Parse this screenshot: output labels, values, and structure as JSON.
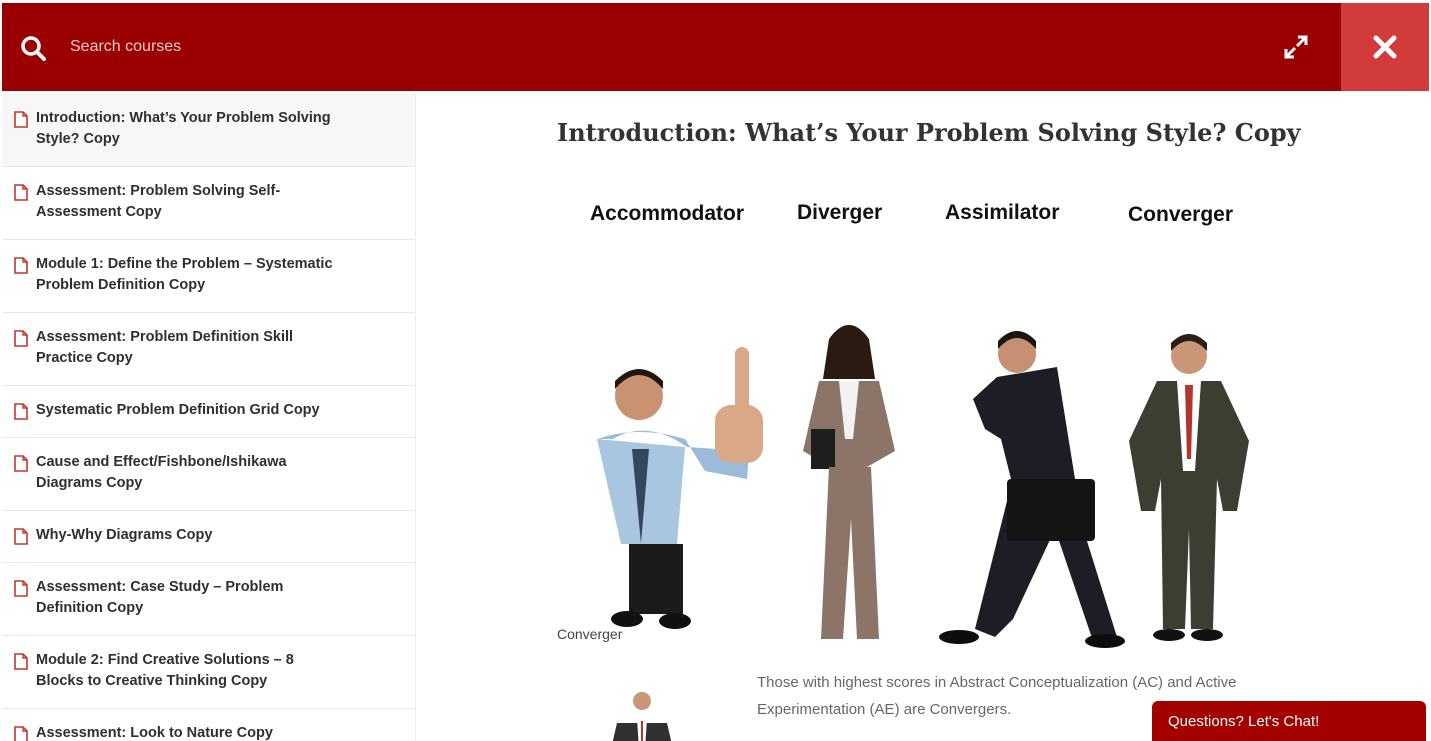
{
  "header": {
    "search_placeholder": "Search courses",
    "search_icon": "search-icon",
    "expand_icon": "expand-icon",
    "close_icon": "close-icon",
    "bar_color": "#9b0000",
    "close_bg_color": "#d23b3b"
  },
  "sidebar": {
    "items": [
      {
        "label": "Introduction: What’s Your Problem Solving Style? Copy",
        "icon": "document-icon"
      },
      {
        "label": "Assessment: Problem Solving Self-Assessment Copy",
        "icon": "document-icon"
      },
      {
        "label": "Module 1: Define the Problem – Systematic Problem Definition Copy",
        "icon": "document-icon"
      },
      {
        "label": "Assessment: Problem Definition Skill Practice Copy",
        "icon": "document-icon"
      },
      {
        "label": "Systematic Problem Definition Grid Copy",
        "icon": "document-icon"
      },
      {
        "label": "Cause and Effect/Fishbone/Ishikawa Diagrams Copy",
        "icon": "document-icon"
      },
      {
        "label": "Why-Why Diagrams Copy",
        "icon": "document-icon"
      },
      {
        "label": "Assessment: Case Study – Problem Definition Copy",
        "icon": "document-icon"
      },
      {
        "label": "Module 2: Find Creative Solutions – 8 Blocks to Creative Thinking Copy",
        "icon": "document-icon"
      },
      {
        "label": "Assessment: Look to Nature Copy",
        "icon": "document-icon"
      }
    ]
  },
  "main": {
    "title": "Introduction: What’s Your Problem Solving Style? Copy",
    "figure_labels": [
      "Accommodator",
      "Diverger",
      "Assimilator",
      "Converger"
    ],
    "caption": "Converger",
    "description": "Those with highest scores in Abstract Conceptualization (AC) and Active Experimentation (AE) are Convergers."
  },
  "chat": {
    "label": "Questions? Let's Chat!",
    "color": "#a30000"
  }
}
